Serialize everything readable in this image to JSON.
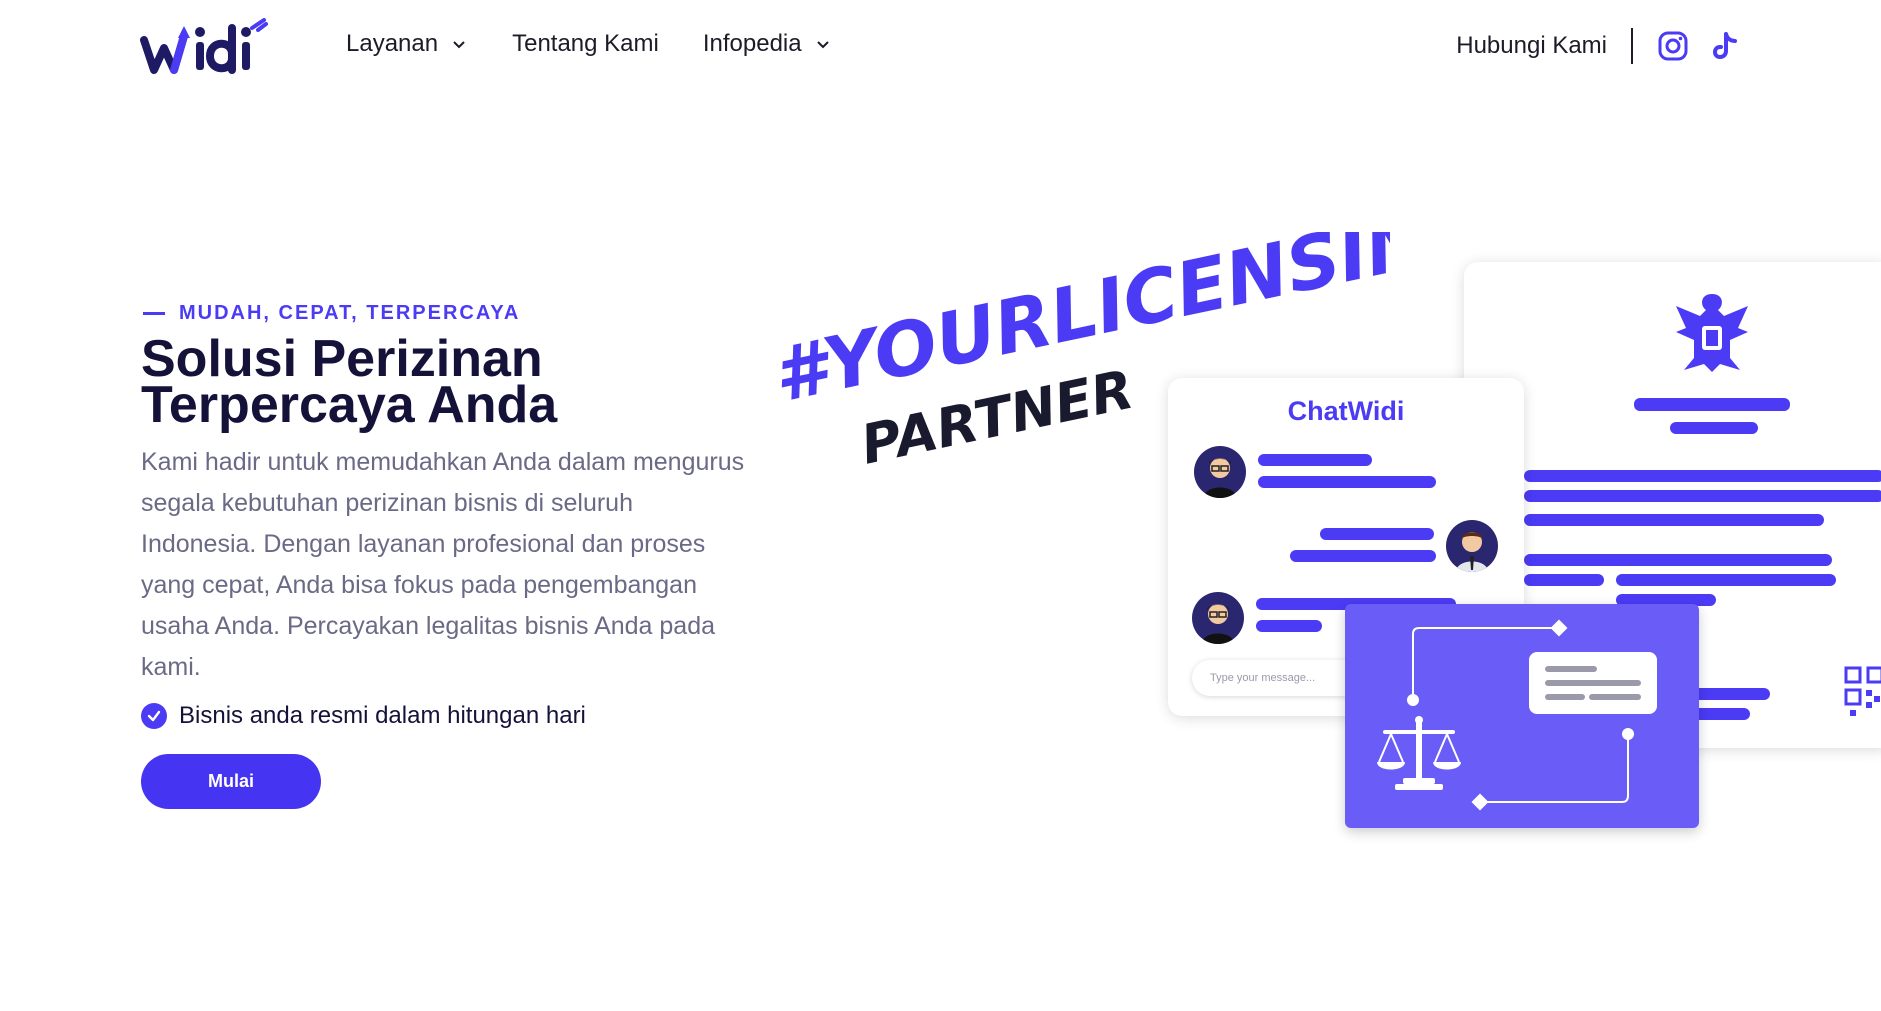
{
  "brand": {
    "name": "Widi",
    "accent": "#4B3BF5"
  },
  "nav": {
    "items": [
      {
        "label": "Layanan",
        "has_dropdown": true
      },
      {
        "label": "Tentang Kami",
        "has_dropdown": false
      },
      {
        "label": "Infopedia",
        "has_dropdown": true
      }
    ],
    "contact_label": "Hubungi Kami",
    "social_icons": [
      "instagram-icon",
      "tiktok-icon"
    ]
  },
  "hero": {
    "eyebrow": "MUDAH, CEPAT, TERPERCAYA",
    "title": "Solusi Perizinan Terpercaya Anda",
    "description": "Kami hadir untuk memudahkan Anda dalam mengurus segala kebutuhan perizinan bisnis di seluruh Indonesia. Dengan layanan profesional dan proses yang cepat, Anda bisa fokus pada pengembangan usaha Anda. Percayakan legalitas bisnis Anda pada kami.",
    "check_text": "Bisnis anda resmi dalam hitungan hari",
    "cta_label": "Mulai"
  },
  "illustration": {
    "hashtag_line1": "#YOURLICENSING",
    "hashtag_line2": "PARTNER",
    "chat_title": "ChatWidi",
    "chat_placeholder": "Type your message..."
  }
}
